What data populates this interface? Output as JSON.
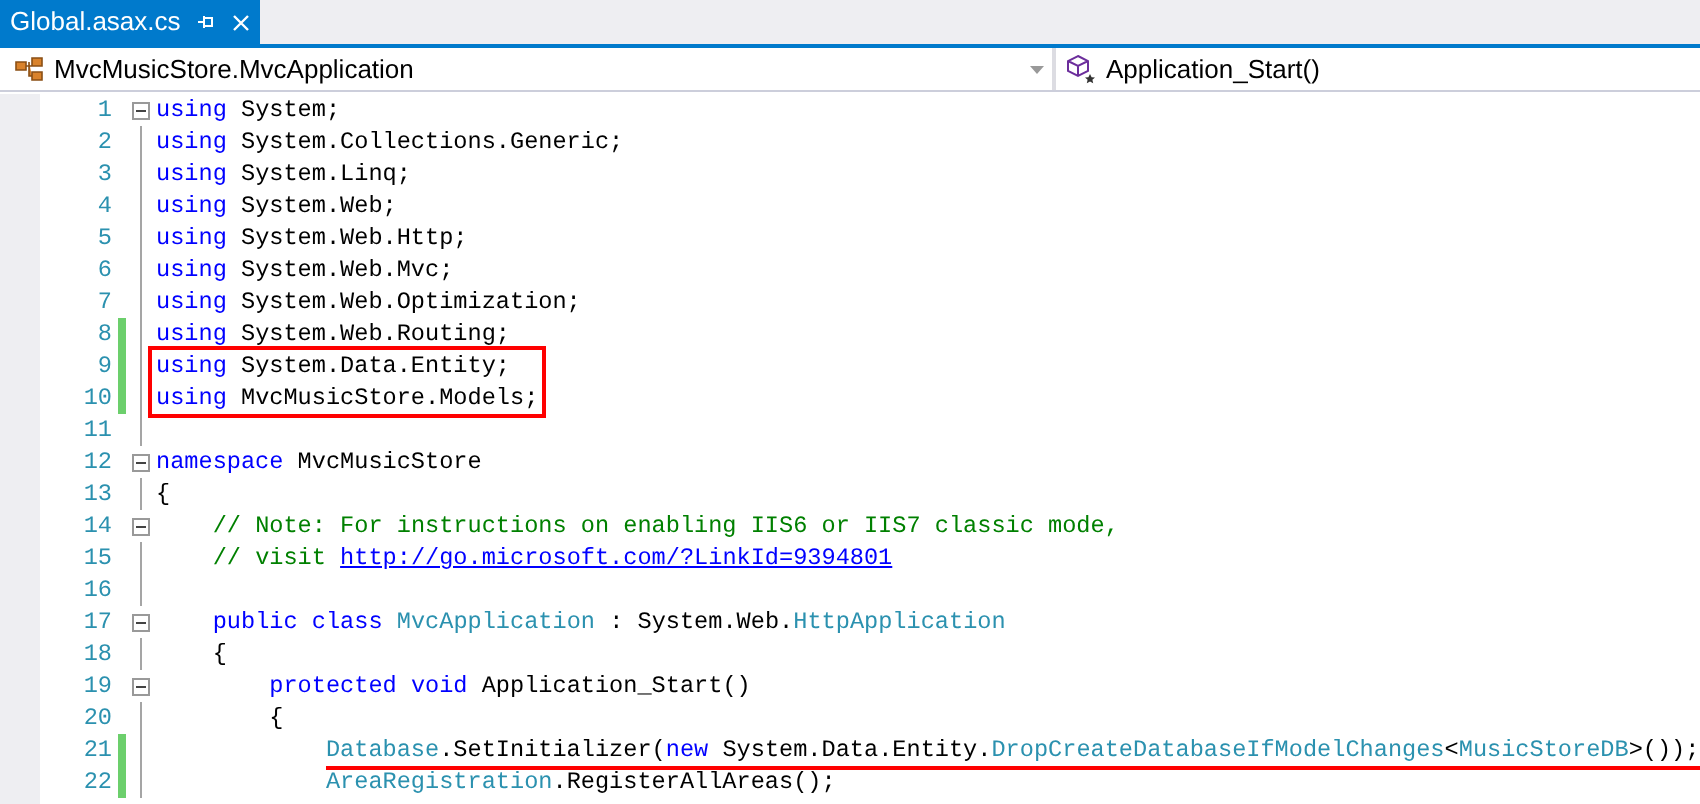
{
  "tabs": [
    {
      "label": "Global.asax.cs",
      "selected": true
    }
  ],
  "navigation": {
    "type_dropdown": "MvcMusicStore.MvcApplication",
    "member_dropdown": "Application_Start()"
  },
  "lines": [
    {
      "number": "1",
      "fold_box": true,
      "changed": false,
      "boxed": false,
      "underlined": false,
      "tokens": [
        {
          "kind": "keyword",
          "text": "using"
        },
        {
          "kind": "plain",
          "text": " System;"
        }
      ]
    },
    {
      "number": "2",
      "fold_box": false,
      "changed": false,
      "boxed": false,
      "underlined": false,
      "tokens": [
        {
          "kind": "keyword",
          "text": "using"
        },
        {
          "kind": "plain",
          "text": " System.Collections.Generic;"
        }
      ]
    },
    {
      "number": "3",
      "fold_box": false,
      "changed": false,
      "boxed": false,
      "underlined": false,
      "tokens": [
        {
          "kind": "keyword",
          "text": "using"
        },
        {
          "kind": "plain",
          "text": " System.Linq;"
        }
      ]
    },
    {
      "number": "4",
      "fold_box": false,
      "changed": false,
      "boxed": false,
      "underlined": false,
      "tokens": [
        {
          "kind": "keyword",
          "text": "using"
        },
        {
          "kind": "plain",
          "text": " System.Web;"
        }
      ]
    },
    {
      "number": "5",
      "fold_box": false,
      "changed": false,
      "boxed": false,
      "underlined": false,
      "tokens": [
        {
          "kind": "keyword",
          "text": "using"
        },
        {
          "kind": "plain",
          "text": " System.Web.Http;"
        }
      ]
    },
    {
      "number": "6",
      "fold_box": false,
      "changed": false,
      "boxed": false,
      "underlined": false,
      "tokens": [
        {
          "kind": "keyword",
          "text": "using"
        },
        {
          "kind": "plain",
          "text": " System.Web.Mvc;"
        }
      ]
    },
    {
      "number": "7",
      "fold_box": false,
      "changed": false,
      "boxed": false,
      "underlined": false,
      "tokens": [
        {
          "kind": "keyword",
          "text": "using"
        },
        {
          "kind": "plain",
          "text": " System.Web.Optimization;"
        }
      ]
    },
    {
      "number": "8",
      "fold_box": false,
      "changed": true,
      "boxed": false,
      "underlined": false,
      "tokens": [
        {
          "kind": "keyword",
          "text": "using"
        },
        {
          "kind": "plain",
          "text": " System.Web.Routing;"
        }
      ]
    },
    {
      "number": "9",
      "fold_box": false,
      "changed": true,
      "boxed": true,
      "underlined": false,
      "tokens": [
        {
          "kind": "keyword",
          "text": "using"
        },
        {
          "kind": "plain",
          "text": " System.Data.Entity;"
        }
      ]
    },
    {
      "number": "10",
      "fold_box": false,
      "changed": true,
      "boxed": true,
      "underlined": false,
      "tokens": [
        {
          "kind": "keyword",
          "text": "using"
        },
        {
          "kind": "plain",
          "text": " MvcMusicStore.Models;"
        }
      ]
    },
    {
      "number": "11",
      "fold_box": false,
      "changed": false,
      "boxed": false,
      "underlined": false
    },
    {
      "number": "12",
      "fold_box": true,
      "changed": false,
      "boxed": false,
      "underlined": false,
      "tokens": [
        {
          "kind": "keyword",
          "text": "namespace"
        },
        {
          "kind": "plain",
          "text": " MvcMusicStore"
        }
      ]
    },
    {
      "number": "13",
      "fold_box": false,
      "changed": false,
      "boxed": false,
      "underlined": false,
      "tokens": [
        {
          "kind": "plain",
          "text": "{"
        }
      ]
    },
    {
      "number": "14",
      "fold_box": true,
      "changed": false,
      "boxed": false,
      "underlined": false,
      "tokens": [
        {
          "kind": "comment",
          "text": "    // Note: For instructions on enabling IIS6 or IIS7 classic mode,"
        }
      ]
    },
    {
      "number": "15",
      "fold_box": false,
      "changed": false,
      "boxed": false,
      "underlined": false,
      "tokens": [
        {
          "kind": "comment",
          "text": "    // visit "
        },
        {
          "kind": "link",
          "text": "http://go.microsoft.com/?LinkId=9394801"
        }
      ]
    },
    {
      "number": "16",
      "fold_box": false,
      "changed": false,
      "boxed": false,
      "underlined": false
    },
    {
      "number": "17",
      "fold_box": true,
      "changed": false,
      "boxed": false,
      "underlined": false,
      "tokens": [
        {
          "kind": "keyword",
          "text": "    public"
        },
        {
          "kind": "keyword",
          "text": " class"
        },
        {
          "kind": "type",
          "text": " MvcApplication"
        },
        {
          "kind": "plain",
          "text": " : System.Web."
        },
        {
          "kind": "type",
          "text": "HttpApplication"
        }
      ]
    },
    {
      "number": "18",
      "fold_box": false,
      "changed": false,
      "boxed": false,
      "underlined": false,
      "tokens": [
        {
          "kind": "plain",
          "text": "    {"
        }
      ]
    },
    {
      "number": "19",
      "fold_box": true,
      "changed": false,
      "boxed": false,
      "underlined": false,
      "tokens": [
        {
          "kind": "keyword",
          "text": "        protected"
        },
        {
          "kind": "keyword",
          "text": " void"
        },
        {
          "kind": "plain",
          "text": " Application_Start()"
        }
      ]
    },
    {
      "number": "20",
      "fold_box": false,
      "changed": false,
      "boxed": false,
      "underlined": false,
      "tokens": [
        {
          "kind": "plain",
          "text": "        {"
        }
      ]
    },
    {
      "number": "21",
      "fold_box": false,
      "changed": true,
      "boxed": false,
      "underlined": true,
      "tokens": [
        {
          "kind": "type",
          "text": "            Database"
        },
        {
          "kind": "plain",
          "text": ".SetInitializer("
        },
        {
          "kind": "keyword",
          "text": "new"
        },
        {
          "kind": "plain",
          "text": " System.Data.Entity."
        },
        {
          "kind": "type",
          "text": "DropCreateDatabaseIfModelChanges"
        },
        {
          "kind": "plain",
          "text": "<"
        },
        {
          "kind": "type",
          "text": "MusicStoreDB"
        },
        {
          "kind": "plain",
          "text": ">());"
        }
      ]
    },
    {
      "number": "22",
      "fold_box": false,
      "changed": true,
      "boxed": false,
      "underlined": false,
      "tokens": [
        {
          "kind": "type",
          "text": "            AreaRegistration"
        },
        {
          "kind": "plain",
          "text": ".RegisterAllAreas();"
        }
      ]
    }
  ]
}
